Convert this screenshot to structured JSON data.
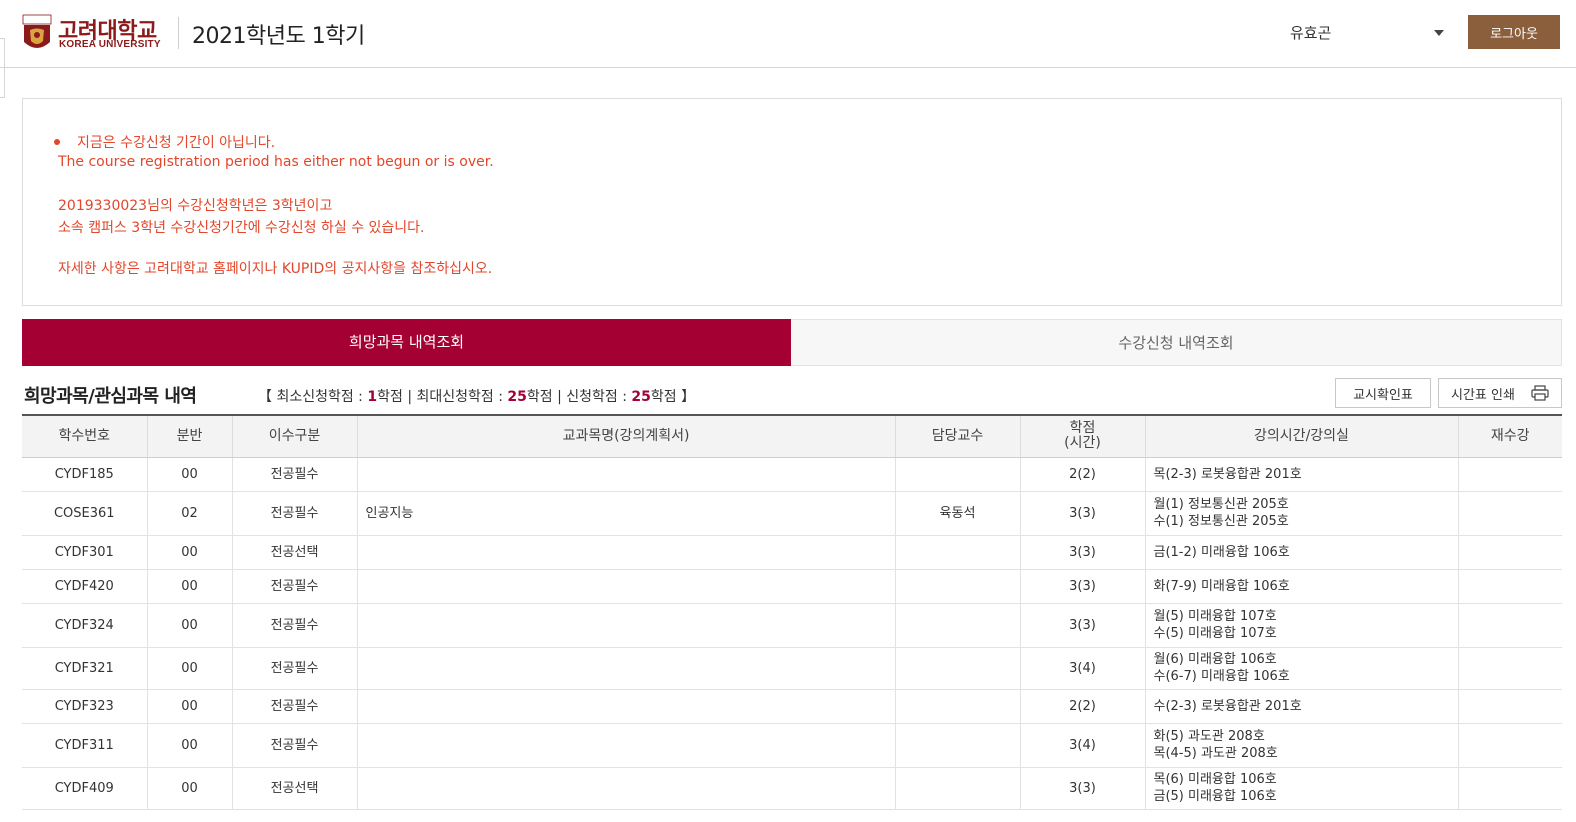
{
  "header": {
    "logo_ko": "고려대학교",
    "logo_en": "KOREA UNIVERSITY",
    "page_title": "2021학년도 1학기",
    "user_name": "유효곤",
    "logout_label": "로그아웃"
  },
  "notice": {
    "line1": "지금은 수강신청 기간이 아닙니다.",
    "line2": "The course registration period has either not begun or is over.",
    "line3": "2019330023님의 수강신청학년은 3학년이고",
    "line4": "소속 캠퍼스 3학년 수강신청기간에 수강신청 하실 수 있습니다.",
    "line5": "자세한 사항은 고려대학교 홈페이지나 KUPID의 공지사항을 참조하십시오.",
    "color": "#e2462c"
  },
  "tabs": {
    "active": "희망과목 내역조회",
    "inactive": "수강신청 내역조회"
  },
  "section": {
    "title": "희망과목/관심과목 내역",
    "bracket_open": "【",
    "min_label": " 최소신청학점 : ",
    "min_value": "1",
    "unit": "학점",
    "sep": " | ",
    "max_label": "최대신청학점 : ",
    "max_value": "25",
    "applied_label": "신청학점 : ",
    "applied_value": "25",
    "bracket_close": " 】"
  },
  "buttons": {
    "confirm": "교시확인표",
    "print": "시간표 인쇄"
  },
  "table": {
    "headers": [
      "학수번호",
      "분반",
      "이수구분",
      "교과목명(강의계획서)",
      "담당교수",
      "학점\n(시간)",
      "강의시간/강의실",
      "재수강"
    ],
    "rows": [
      {
        "code": "CYDF185",
        "section": "00",
        "type": "전공필수",
        "name": "",
        "prof": "",
        "credit": "2(2)",
        "time1": "목(2-3) 로봇융합관 201호",
        "time2": "",
        "retake": ""
      },
      {
        "code": "COSE361",
        "section": "02",
        "type": "전공필수",
        "name": "인공지능",
        "prof": "육동석",
        "credit": "3(3)",
        "time1": "월(1) 정보통신관 205호",
        "time2": "수(1) 정보통신관 205호",
        "retake": ""
      },
      {
        "code": "CYDF301",
        "section": "00",
        "type": "전공선택",
        "name": "",
        "prof": "",
        "credit": "3(3)",
        "time1": "금(1-2) 미래융합 106호",
        "time2": "",
        "retake": ""
      },
      {
        "code": "CYDF420",
        "section": "00",
        "type": "전공필수",
        "name": "",
        "prof": "",
        "credit": "3(3)",
        "time1": "화(7-9) 미래융합 106호",
        "time2": "",
        "retake": ""
      },
      {
        "code": "CYDF324",
        "section": "00",
        "type": "전공필수",
        "name": "",
        "prof": "",
        "credit": "3(3)",
        "time1": "월(5) 미래융합 107호",
        "time2": "수(5) 미래융합 107호",
        "retake": ""
      },
      {
        "code": "CYDF321",
        "section": "00",
        "type": "전공필수",
        "name": "",
        "prof": "",
        "credit": "3(4)",
        "time1": "월(6) 미래융합 106호",
        "time2": "수(6-7) 미래융합 106호",
        "retake": ""
      },
      {
        "code": "CYDF323",
        "section": "00",
        "type": "전공필수",
        "name": "",
        "prof": "",
        "credit": "2(2)",
        "time1": "수(2-3) 로봇융합관 201호",
        "time2": "",
        "retake": ""
      },
      {
        "code": "CYDF311",
        "section": "00",
        "type": "전공필수",
        "name": "",
        "prof": "",
        "credit": "3(4)",
        "time1": "화(5) 과도관 208호",
        "time2": "목(4-5) 과도관 208호",
        "retake": ""
      },
      {
        "code": "CYDF409",
        "section": "00",
        "type": "전공선택",
        "name": "",
        "prof": "",
        "credit": "3(3)",
        "time1": "목(6) 미래융합 106호",
        "time2": "금(5) 미래융합 106호",
        "retake": ""
      }
    ]
  },
  "colors": {
    "brand": "#8b1a1a",
    "tab_active": "#a50034",
    "logout": "#8b5e3c"
  },
  "icons": {
    "logo": "korea-university-crest",
    "print": "printer-icon",
    "caret": "chevron-down-icon"
  }
}
